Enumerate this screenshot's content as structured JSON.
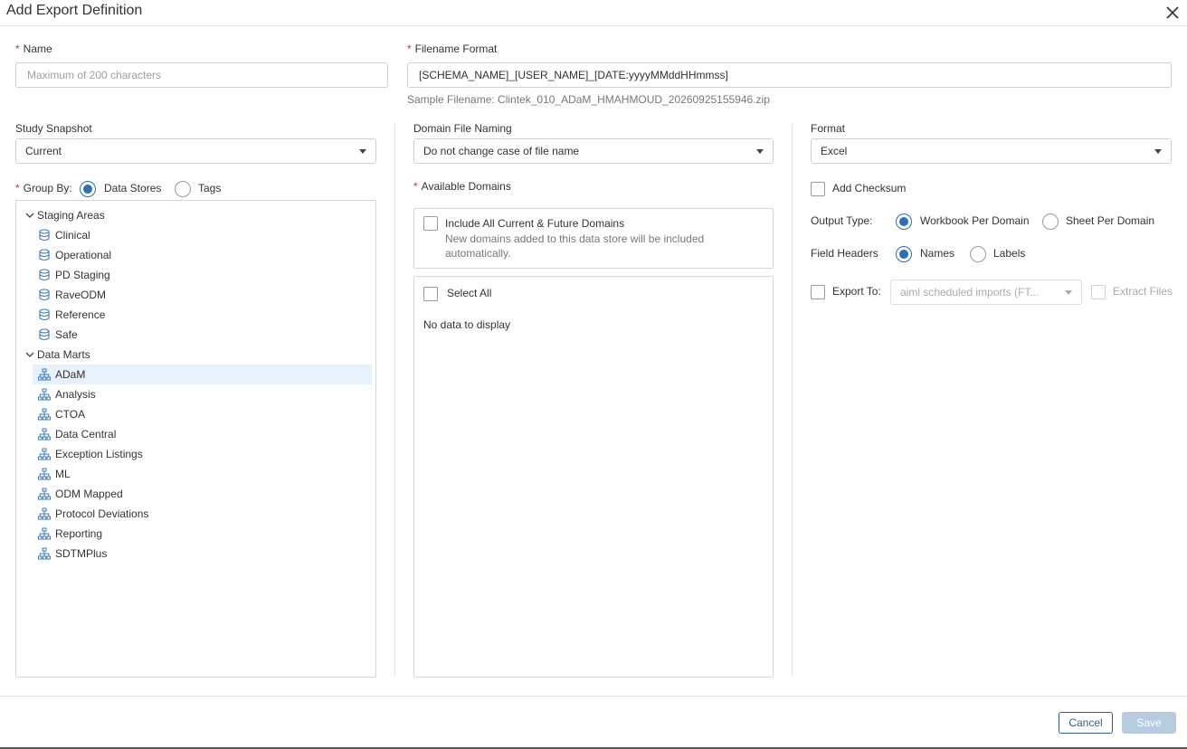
{
  "dialog": {
    "title": "Add Export Definition",
    "close_icon": "close-icon"
  },
  "name": {
    "label": "Name",
    "value": "",
    "placeholder": "Maximum of 200 characters"
  },
  "filename_format": {
    "label": "Filename Format",
    "value": "[SCHEMA_NAME]_[USER_NAME]_[DATE:yyyyMMddHHmmss]",
    "sample": "Sample Filename: Clintek_010_ADaM_HMAHMOUD_20260925155946.zip"
  },
  "study_snapshot": {
    "label": "Study Snapshot",
    "selected": "Current"
  },
  "group_by": {
    "label": "Group By:",
    "options": [
      {
        "label": "Data Stores",
        "selected": true
      },
      {
        "label": "Tags",
        "selected": false
      }
    ]
  },
  "tree": {
    "groups": [
      {
        "label": "Staging Areas",
        "icon": "chevron-down-icon",
        "item_icon": "database-icon",
        "items": [
          "Clinical",
          "Operational",
          "PD Staging",
          "RaveODM",
          "Reference",
          "Safe"
        ]
      },
      {
        "label": "Data Marts",
        "icon": "chevron-down-icon",
        "item_icon": "hierarchy-icon",
        "items": [
          "ADaM",
          "Analysis",
          "CTOA",
          "Data Central",
          "Exception Listings",
          "ML",
          "ODM Mapped",
          "Protocol Deviations",
          "Reporting",
          "SDTMPlus"
        ]
      }
    ],
    "selected": "ADaM"
  },
  "domain_file_naming": {
    "label": "Domain File Naming",
    "selected": "Do not change case of file name"
  },
  "available_domains": {
    "label": "Available Domains",
    "include_all_label": "Include All Current & Future Domains",
    "include_all_desc_1": "New domains added to this data store will be included",
    "include_all_desc_2": "automatically.",
    "select_all_label": "Select All",
    "empty_text": "No data to display"
  },
  "format": {
    "label": "Format",
    "selected": "Excel"
  },
  "add_checksum": {
    "label": "Add Checksum",
    "checked": false
  },
  "output_type": {
    "label": "Output Type:",
    "options": [
      {
        "label": "Workbook Per Domain",
        "selected": true
      },
      {
        "label": "Sheet Per Domain",
        "selected": false
      }
    ]
  },
  "field_headers": {
    "label": "Field Headers",
    "options": [
      {
        "label": "Names",
        "selected": true
      },
      {
        "label": "Labels",
        "selected": false
      }
    ]
  },
  "export_to": {
    "label": "Export To:",
    "selected": "aiml scheduled imports (FT...",
    "extract_files_label": "Extract Files"
  },
  "footer": {
    "cancel_label": "Cancel",
    "save_label": "Save"
  },
  "colors": {
    "accent": "#2f6db5",
    "required": "#c0392b",
    "selected_row": "#e6f1fb",
    "save_disabled": "#b7cbe0"
  }
}
